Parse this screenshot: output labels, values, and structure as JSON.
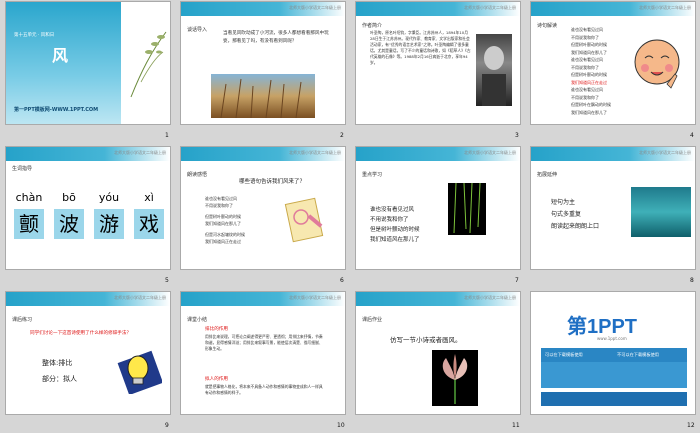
{
  "brand": "北师大版小学语文二年级上册",
  "slide_numbers": [
    "1",
    "2",
    "3",
    "4",
    "5",
    "6",
    "7",
    "8",
    "9",
    "10",
    "11",
    "12"
  ],
  "s1": {
    "subtitle": "第十五单元 · 风和日",
    "title": "风",
    "footer": "第一PPT模板网-WWW.1PPT.COM"
  },
  "s2": {
    "tag": "谈话导入",
    "text": "当看见风吹动成了小河流，很多人都想看看那风中玩耍，那看见了吗，有没有看到风呢？"
  },
  "s3": {
    "tag": "作者简介",
    "text": "叶圣陶，原名叶绍钧，字秉臣。江苏苏州人，1894年10月28日生于江苏苏州。现代作家、教育家、文学出版家和社会活动家，有“优秀的语言艺术家”之称。叶圣陶编辑了很多童话，尤其是童话，写了不少的童话和诗歌，如《稻草人》《古代英雄的石像》等。1988年2月16日病逝于北京，享年94岁。"
  },
  "s4": {
    "tag": "诗句解读",
    "lines": [
      "谁也没有看见过风",
      "不用说我和你了",
      "但是树叶颤动的时候",
      "我们知道风在那儿了",
      "谁也没有看见过风",
      "不用说我和你了",
      "但是树叶颤动的时候",
      "我们知道风正在走过",
      "谁也没有看见过风",
      "不用说我和你了",
      "但是树叶在飘动的时候",
      "我们知道风在那儿了"
    ]
  },
  "s5": {
    "tag": "生词指导",
    "chars": [
      {
        "py": "chàn",
        "hz": "颤"
      },
      {
        "py": "bō",
        "hz": "波"
      },
      {
        "py": "yóu",
        "hz": "游"
      },
      {
        "py": "xì",
        "hz": "戏"
      }
    ]
  },
  "s6": {
    "tag": "朗读感悟",
    "question": "哪些语句告诉我们风来了？",
    "lines": [
      "谁也没有看见过风",
      "不用说我和你了",
      "但是树叶颤动的时候",
      "我们知道风在那儿了",
      "谁也没有看见过风",
      "不用说我和你了",
      "但是河水起皱纹的时候",
      "我们知道风正在走过"
    ]
  },
  "s7": {
    "tag": "重点学习",
    "lines": [
      "谁也没有看见过风",
      "不用说我和你了",
      "但是树叶颤动的时候",
      "我们知道风在那儿了"
    ]
  },
  "s8": {
    "tag": "拓展延伸",
    "lines": [
      "短句为主",
      "句式多重复",
      "朗读起来朗朗上口"
    ]
  },
  "s9": {
    "tag": "课后练习",
    "question": "同学们讨论一下这首诗使用了什么样的修辞手法？",
    "a1": "整体:排比",
    "a2": "部分：拟人"
  },
  "s10": {
    "tag": "课堂小结",
    "h1": "排比的作用",
    "p1": "用排比来说理，可把论点阐述得更严密、更透彻；用排比来抒情，节奏和谐，显得感情洋溢；用排比来叙事写景，能使层次清楚、描写细腻、形象生动。",
    "h2": "拟人的作用",
    "p2": "就是把事物人格化，将本来不具备人动作和感情的事物变成和人一样具有动作和感情的样子。"
  },
  "s11": {
    "tag": "课后作业",
    "text": "仿写一节小诗或者画风。"
  },
  "s12": {
    "logo": "第1PPT",
    "url": "www.1ppt.com",
    "btn1": "可以在下载模板使用",
    "btn2": "不可以在下载模板使用"
  }
}
